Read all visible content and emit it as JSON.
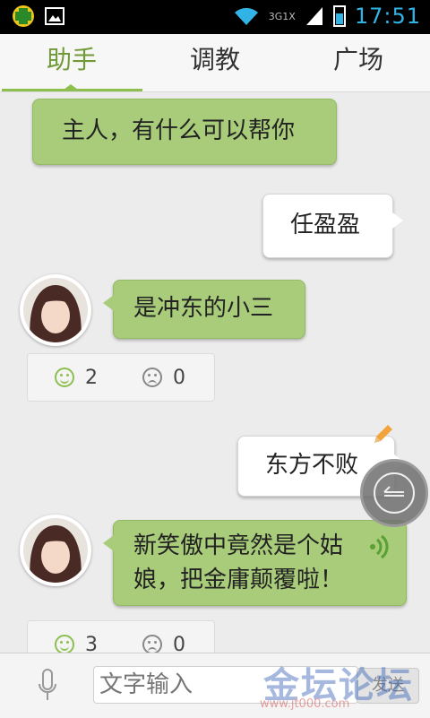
{
  "status_bar": {
    "network": "3G1X",
    "time": "17:51"
  },
  "tabs": [
    {
      "label": "助手",
      "active": true
    },
    {
      "label": "调教",
      "active": false
    },
    {
      "label": "广场",
      "active": false
    }
  ],
  "messages": [
    {
      "from": "assistant",
      "text": "主人，有什么可以帮你"
    },
    {
      "from": "user",
      "text": "任盈盈"
    },
    {
      "from": "assistant",
      "text": "是冲东的小三",
      "likes": "2",
      "dislikes": "0"
    },
    {
      "from": "user",
      "text": "东方不败"
    },
    {
      "from": "assistant",
      "text_line1": "新笑傲中竟然是个姑",
      "text_line2": "娘，把金庸颠覆啦！",
      "likes": "3",
      "dislikes": "0"
    }
  ],
  "input_bar": {
    "placeholder": "文字输入",
    "send_label": "发送"
  },
  "watermark": {
    "title": "金坛论坛",
    "url": "www.jt000.com"
  },
  "colors": {
    "accent_green": "#8cbf4d",
    "bubble_green": "#a8cc7a",
    "time_blue": "#32b3e6"
  }
}
